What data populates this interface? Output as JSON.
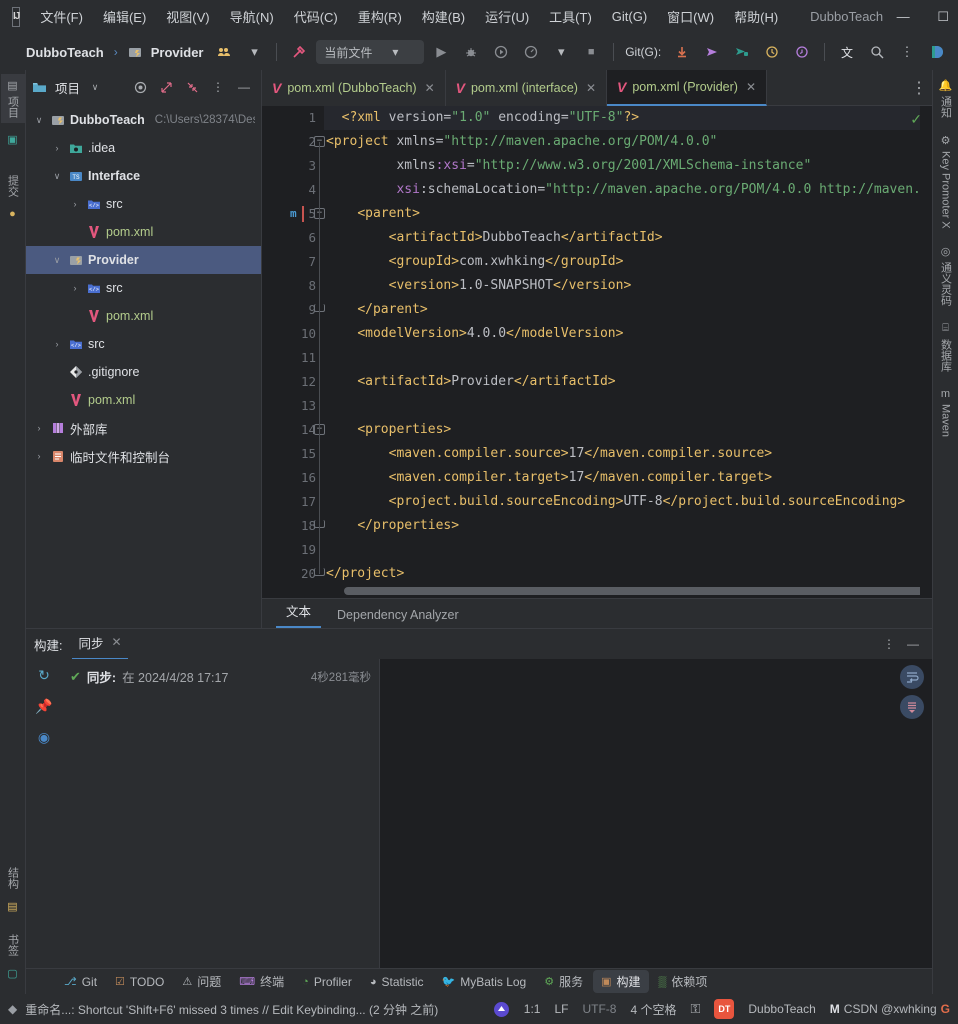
{
  "window": {
    "title": "DubboTeach",
    "logo": "IJ",
    "minimize": "—",
    "maximize": "☐",
    "close": "✕"
  },
  "menu": {
    "items": [
      {
        "label": "文件(F)",
        "name": "menu-file"
      },
      {
        "label": "编辑(E)",
        "name": "menu-edit"
      },
      {
        "label": "视图(V)",
        "name": "menu-view"
      },
      {
        "label": "导航(N)",
        "name": "menu-navigate"
      },
      {
        "label": "代码(C)",
        "name": "menu-code"
      },
      {
        "label": "重构(R)",
        "name": "menu-refactor"
      },
      {
        "label": "构建(B)",
        "name": "menu-build"
      },
      {
        "label": "运行(U)",
        "name": "menu-run"
      },
      {
        "label": "工具(T)",
        "name": "menu-tools"
      },
      {
        "label": "Git(G)",
        "name": "menu-git"
      },
      {
        "label": "窗口(W)",
        "name": "menu-window"
      },
      {
        "label": "帮助(H)",
        "name": "menu-help"
      }
    ]
  },
  "toolbar": {
    "breadcrumb_project": "DubboTeach",
    "breadcrumb_sep": "›",
    "breadcrumb_module": "Provider",
    "run_config": "当前文件",
    "run_config_caret": "▾",
    "git_label": "Git(G):",
    "icons": {
      "share": "share-icon",
      "caret": "▾",
      "hammer": "hammer-icon",
      "run": "▶",
      "debug": "debug-icon",
      "run_coverage": "coverage-icon",
      "profile": "profile-icon",
      "stop": "■",
      "update": "update-project-icon",
      "push": "push-icon",
      "commit": "commit-icon",
      "history": "history-icon",
      "rollback": "rollback-icon",
      "translate": "文",
      "search": "search-icon",
      "more": "⋮",
      "ai": "ai-assistant-icon"
    }
  },
  "left_strip": {
    "top": [
      {
        "label": "项目",
        "name": "sidebar-item-project",
        "selected": true,
        "glyph": "▤"
      },
      {
        "label": "",
        "name": "sidebar-item-monitor",
        "selected": false,
        "glyph": "⬚"
      }
    ],
    "mid": [
      {
        "label": "提交",
        "name": "sidebar-item-commit",
        "selected": false,
        "glyph": "⬦"
      }
    ],
    "bottom": [
      {
        "label": "结构",
        "name": "sidebar-item-structure",
        "selected": false,
        "glyph": "▥"
      },
      {
        "label": "书签",
        "name": "sidebar-item-bookmarks",
        "selected": false,
        "glyph": "▮"
      }
    ]
  },
  "right_strip": {
    "items": [
      {
        "label": "通知",
        "name": "sidebar-item-notifications",
        "glyph": "🔔"
      },
      {
        "label": "Key Promoter X",
        "name": "sidebar-item-key-promoter-x",
        "glyph": "⚙"
      },
      {
        "label": "通义灵码",
        "name": "sidebar-item-tongyi-lingma",
        "glyph": "◎"
      },
      {
        "label": "数据库",
        "name": "sidebar-item-database",
        "glyph": "⌸"
      },
      {
        "label": "Maven",
        "name": "sidebar-item-maven",
        "glyph": "m"
      }
    ]
  },
  "project_panel": {
    "title": "项目",
    "title_caret": "∨",
    "icons": {
      "target": "locate-icon",
      "expand": "expand-icon",
      "collapse": "collapse-icon",
      "more": "⋮",
      "hide": "—"
    },
    "tree": [
      {
        "label": "DubboTeach",
        "path": "C:\\Users\\28374\\Des",
        "indent": 0,
        "arrow": "∨",
        "icon": "module-icon",
        "bold": true,
        "selected": false,
        "kind": "root"
      },
      {
        "label": ".idea",
        "path": "",
        "indent": 1,
        "arrow": "›",
        "icon": "folder-idea-icon",
        "bold": false,
        "selected": false,
        "kind": "folder"
      },
      {
        "label": "Interface",
        "path": "",
        "indent": 1,
        "arrow": "∨",
        "icon": "module-ts-icon",
        "bold": true,
        "selected": false,
        "kind": "module"
      },
      {
        "label": "src",
        "path": "",
        "indent": 2,
        "arrow": "›",
        "icon": "folder-src-icon",
        "bold": false,
        "selected": false,
        "kind": "folder"
      },
      {
        "label": "pom.xml",
        "path": "",
        "indent": 2,
        "arrow": "",
        "icon": "maven-file-icon",
        "bold": false,
        "selected": false,
        "kind": "xml"
      },
      {
        "label": "Provider",
        "path": "",
        "indent": 1,
        "arrow": "∨",
        "icon": "module-icon",
        "bold": true,
        "selected": true,
        "kind": "module"
      },
      {
        "label": "src",
        "path": "",
        "indent": 2,
        "arrow": "›",
        "icon": "folder-src-icon",
        "bold": false,
        "selected": false,
        "kind": "folder"
      },
      {
        "label": "pom.xml",
        "path": "",
        "indent": 2,
        "arrow": "",
        "icon": "maven-file-icon",
        "bold": false,
        "selected": false,
        "kind": "xml"
      },
      {
        "label": "src",
        "path": "",
        "indent": 1,
        "arrow": "›",
        "icon": "folder-src-icon",
        "bold": false,
        "selected": false,
        "kind": "folder"
      },
      {
        "label": ".gitignore",
        "path": "",
        "indent": 1,
        "arrow": "",
        "icon": "git-file-icon",
        "bold": false,
        "selected": false,
        "kind": "git"
      },
      {
        "label": "pom.xml",
        "path": "",
        "indent": 1,
        "arrow": "",
        "icon": "maven-file-icon",
        "bold": false,
        "selected": false,
        "kind": "xml"
      },
      {
        "label": "外部库",
        "path": "",
        "indent": 0,
        "arrow": "›",
        "icon": "external-libraries-icon",
        "bold": false,
        "selected": false,
        "kind": "lib"
      },
      {
        "label": "临时文件和控制台",
        "path": "",
        "indent": 0,
        "arrow": "›",
        "icon": "scratches-icon",
        "bold": false,
        "selected": false,
        "kind": "scratch"
      }
    ]
  },
  "editor": {
    "tabs": [
      {
        "label": "pom.xml (DubboTeach)",
        "active": false,
        "name": "tab-pom-dubboteach"
      },
      {
        "label": "pom.xml (interface)",
        "active": false,
        "name": "tab-pom-interface"
      },
      {
        "label": "pom.xml (Provider)",
        "active": true,
        "name": "tab-pom-provider"
      }
    ],
    "tab_close": "✕",
    "tabs_more": "⋮",
    "inspection_ok": "✓",
    "maven_gutter_mark": "m",
    "lines": [
      {
        "n": 1,
        "fold": "",
        "current": true,
        "tokens": [
          {
            "t": "  ",
            "c": "t-txt"
          },
          {
            "t": "<?xml ",
            "c": "t-pi"
          },
          {
            "t": "version=",
            "c": "t-attr"
          },
          {
            "t": "\"1.0\"",
            "c": "t-str"
          },
          {
            "t": " encoding=",
            "c": "t-attr"
          },
          {
            "t": "\"UTF-8\"",
            "c": "t-str"
          },
          {
            "t": "?>",
            "c": "t-pi"
          }
        ]
      },
      {
        "n": 2,
        "fold": "open",
        "current": false,
        "tokens": [
          {
            "t": "<project ",
            "c": "t-tag"
          },
          {
            "t": "xmlns=",
            "c": "t-attr"
          },
          {
            "t": "\"http://maven.apache.org/POM/4.0.0\"",
            "c": "t-str"
          }
        ]
      },
      {
        "n": 3,
        "fold": "",
        "current": false,
        "tokens": [
          {
            "t": "         ",
            "c": "t-txt"
          },
          {
            "t": "xmlns",
            "c": "t-attr"
          },
          {
            "t": ":xsi",
            "c": "t-ns"
          },
          {
            "t": "=",
            "c": "t-attr"
          },
          {
            "t": "\"http://www.w3.org/2001/XMLSchema-instance\"",
            "c": "t-str"
          }
        ]
      },
      {
        "n": 4,
        "fold": "",
        "current": false,
        "tokens": [
          {
            "t": "         ",
            "c": "t-txt"
          },
          {
            "t": "xsi",
            "c": "t-ns"
          },
          {
            "t": ":schemaLocation=",
            "c": "t-attr"
          },
          {
            "t": "\"http://maven.apache.org/POM/4.0.0 http://maven.",
            "c": "t-str"
          }
        ]
      },
      {
        "n": 5,
        "fold": "open",
        "current": false,
        "maven": true,
        "tokens": [
          {
            "t": "    ",
            "c": "t-txt"
          },
          {
            "t": "<parent>",
            "c": "t-tag"
          }
        ]
      },
      {
        "n": 6,
        "fold": "",
        "current": false,
        "tokens": [
          {
            "t": "        ",
            "c": "t-txt"
          },
          {
            "t": "<artifactId>",
            "c": "t-tag"
          },
          {
            "t": "DubboTeach",
            "c": "t-val"
          },
          {
            "t": "</artifactId>",
            "c": "t-tag"
          }
        ]
      },
      {
        "n": 7,
        "fold": "",
        "current": false,
        "tokens": [
          {
            "t": "        ",
            "c": "t-txt"
          },
          {
            "t": "<groupId>",
            "c": "t-tag"
          },
          {
            "t": "com.xwhking",
            "c": "t-val"
          },
          {
            "t": "</groupId>",
            "c": "t-tag"
          }
        ]
      },
      {
        "n": 8,
        "fold": "",
        "current": false,
        "tokens": [
          {
            "t": "        ",
            "c": "t-txt"
          },
          {
            "t": "<version>",
            "c": "t-tag"
          },
          {
            "t": "1.0-SNAPSHOT",
            "c": "t-val"
          },
          {
            "t": "</version>",
            "c": "t-tag"
          }
        ]
      },
      {
        "n": 9,
        "fold": "close",
        "current": false,
        "tokens": [
          {
            "t": "    ",
            "c": "t-txt"
          },
          {
            "t": "</parent>",
            "c": "t-tag"
          }
        ]
      },
      {
        "n": 10,
        "fold": "",
        "current": false,
        "tokens": [
          {
            "t": "    ",
            "c": "t-txt"
          },
          {
            "t": "<modelVersion>",
            "c": "t-tag"
          },
          {
            "t": "4.0.0",
            "c": "t-val"
          },
          {
            "t": "</modelVersion>",
            "c": "t-tag"
          }
        ]
      },
      {
        "n": 11,
        "fold": "",
        "current": false,
        "tokens": []
      },
      {
        "n": 12,
        "fold": "",
        "current": false,
        "tokens": [
          {
            "t": "    ",
            "c": "t-txt"
          },
          {
            "t": "<artifactId>",
            "c": "t-tag"
          },
          {
            "t": "Provider",
            "c": "t-val"
          },
          {
            "t": "</artifactId>",
            "c": "t-tag"
          }
        ]
      },
      {
        "n": 13,
        "fold": "",
        "current": false,
        "tokens": []
      },
      {
        "n": 14,
        "fold": "open",
        "current": false,
        "tokens": [
          {
            "t": "    ",
            "c": "t-txt"
          },
          {
            "t": "<properties>",
            "c": "t-tag"
          }
        ]
      },
      {
        "n": 15,
        "fold": "",
        "current": false,
        "tokens": [
          {
            "t": "        ",
            "c": "t-txt"
          },
          {
            "t": "<maven.compiler.source>",
            "c": "t-tag"
          },
          {
            "t": "17",
            "c": "t-val"
          },
          {
            "t": "</maven.compiler.source>",
            "c": "t-tag"
          }
        ]
      },
      {
        "n": 16,
        "fold": "",
        "current": false,
        "tokens": [
          {
            "t": "        ",
            "c": "t-txt"
          },
          {
            "t": "<maven.compiler.target>",
            "c": "t-tag"
          },
          {
            "t": "17",
            "c": "t-val"
          },
          {
            "t": "</maven.compiler.target>",
            "c": "t-tag"
          }
        ]
      },
      {
        "n": 17,
        "fold": "",
        "current": false,
        "tokens": [
          {
            "t": "        ",
            "c": "t-txt"
          },
          {
            "t": "<project.build.sourceEncoding>",
            "c": "t-tag"
          },
          {
            "t": "UTF-8",
            "c": "t-val"
          },
          {
            "t": "</project.build.sourceEncoding>",
            "c": "t-tag"
          }
        ]
      },
      {
        "n": 18,
        "fold": "close",
        "current": false,
        "tokens": [
          {
            "t": "    ",
            "c": "t-txt"
          },
          {
            "t": "</properties>",
            "c": "t-tag"
          }
        ]
      },
      {
        "n": 19,
        "fold": "",
        "current": false,
        "tokens": []
      },
      {
        "n": 20,
        "fold": "close",
        "current": false,
        "tokens": [
          {
            "t": "</project>",
            "c": "t-tag"
          }
        ]
      }
    ],
    "bottom_tabs": [
      {
        "label": "文本",
        "active": true,
        "name": "ed-tab-text"
      },
      {
        "label": "Dependency Analyzer",
        "active": false,
        "name": "ed-tab-dependency-analyzer"
      }
    ]
  },
  "build_panel": {
    "name": "构建:",
    "tab": "同步",
    "tab_close": "✕",
    "more": "⋮",
    "hide": "—",
    "rail": [
      {
        "glyph": "↻",
        "name": "rerun-icon",
        "color": "#5aa9c9"
      },
      {
        "glyph": "⚑",
        "name": "pin-icon",
        "color": "#b57edc"
      },
      {
        "glyph": "◉",
        "name": "toggle-view-icon",
        "color": "#4a88c7"
      }
    ],
    "sync": {
      "status_icon": "✔",
      "label": "同步:",
      "at": "在 2024/4/28 17:17",
      "duration": "4秒281毫秒"
    },
    "widgets": [
      {
        "glyph": "↵",
        "name": "soft-wrap-icon"
      },
      {
        "glyph": "↓",
        "name": "scroll-to-end-icon"
      }
    ]
  },
  "tool_windows": [
    {
      "label": "Git",
      "glyph": "⎇",
      "color": "#5aa9c9",
      "selected": false,
      "name": "toolwindow-git"
    },
    {
      "label": "TODO",
      "glyph": "☑",
      "color": "#c08a5a",
      "selected": false,
      "name": "toolwindow-todo"
    },
    {
      "label": "问题",
      "glyph": "⚠",
      "color": "#b6b9bd",
      "selected": false,
      "name": "toolwindow-problems"
    },
    {
      "label": "终端",
      "glyph": "⌨",
      "color": "#b57edc",
      "selected": false,
      "name": "toolwindow-terminal"
    },
    {
      "label": "Profiler",
      "glyph": "◔",
      "color": "#5fa857",
      "selected": false,
      "name": "toolwindow-profiler"
    },
    {
      "label": "Statistic",
      "glyph": "◕",
      "color": "#b6b9bd",
      "selected": false,
      "name": "toolwindow-statistic"
    },
    {
      "label": "MyBatis Log",
      "glyph": "🐦",
      "color": "#c05a4a",
      "selected": false,
      "name": "toolwindow-mybatis-log"
    },
    {
      "label": "服务",
      "glyph": "⚙",
      "color": "#5fa857",
      "selected": false,
      "name": "toolwindow-services"
    },
    {
      "label": "构建",
      "glyph": "▣",
      "color": "#c08a5a",
      "selected": true,
      "name": "toolwindow-build"
    },
    {
      "label": "依赖项",
      "glyph": "▒",
      "color": "#5fa857",
      "selected": false,
      "name": "toolwindow-dependencies"
    }
  ],
  "status_bar": {
    "message_icon": "◆",
    "message": "重命名...: Shortcut 'Shift+F6' missed 3 times // Edit Keybinding... (2 分钟 之前)",
    "right": {
      "tongyi_icon": "tongyi-icon",
      "caret_position": "1:1",
      "line_separator": "LF",
      "encoding": "UTF-8",
      "indent": "4 个空格",
      "lock_icon": "⚿",
      "project_badge": "DT",
      "project_name": "DubboTeach",
      "account_icon": "M",
      "account_name": "CSDN @xwhking",
      "google_icon": "G"
    }
  },
  "colors": {
    "accent": "#4a88c7",
    "selection": "#4b5a80",
    "bg_panel": "#2b2d30",
    "bg_editor": "#1e1f22",
    "maven_pink": "#e3577e",
    "ok_green": "#5fa857",
    "xml_green": "#b3cc8c"
  }
}
